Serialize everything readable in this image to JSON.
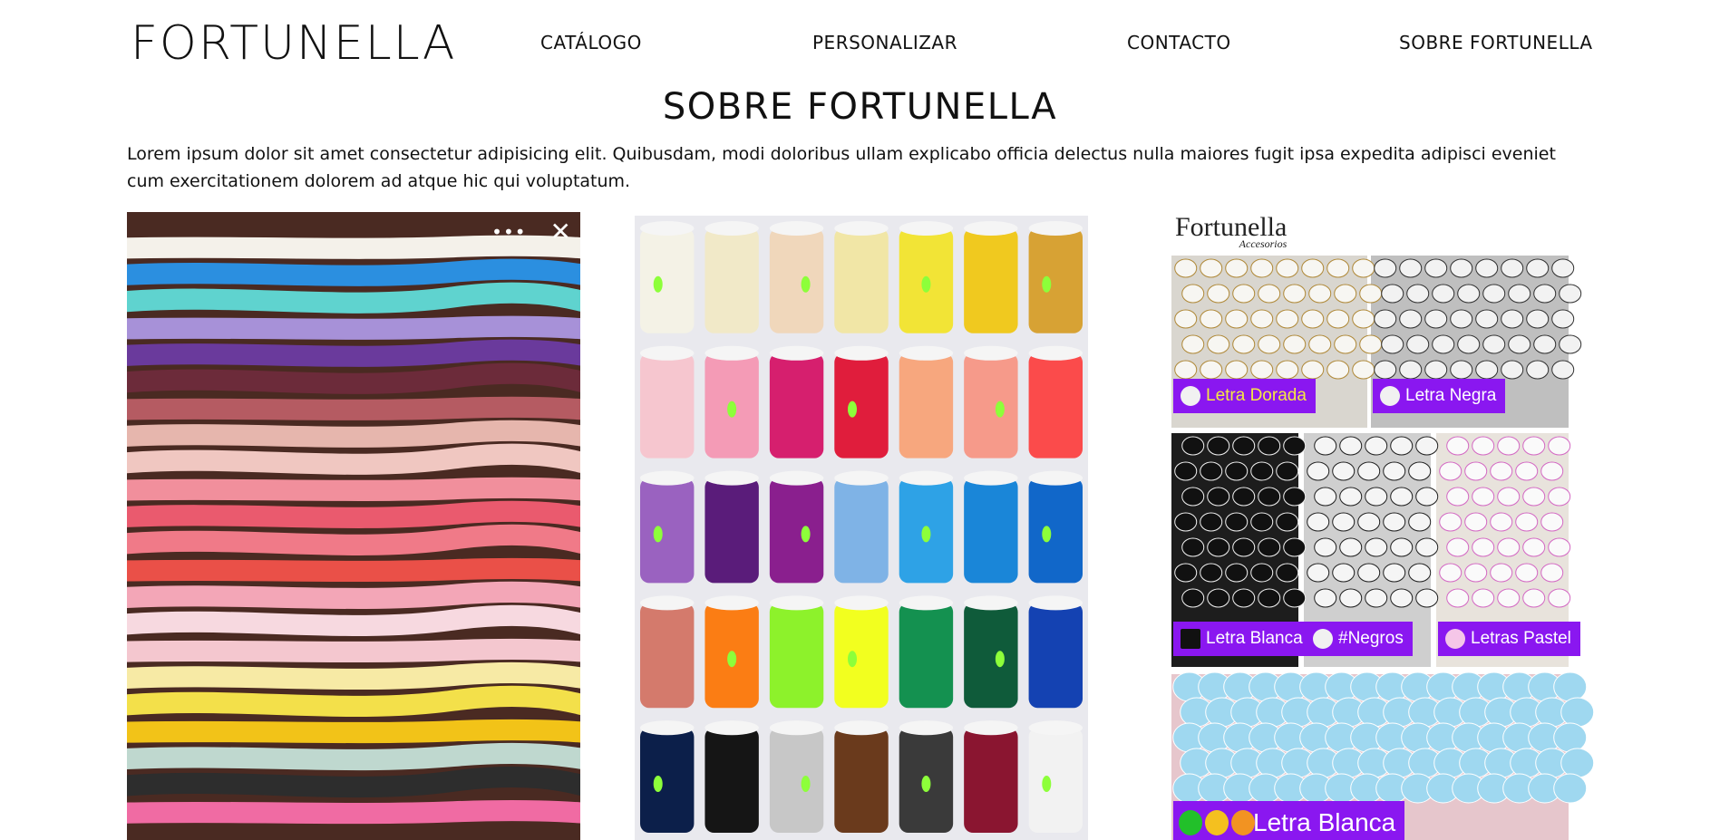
{
  "header": {
    "logo": "FORTUNELLA",
    "nav": [
      {
        "label": "CATÁLOGO"
      },
      {
        "label": "PERSONALIZAR"
      },
      {
        "label": "CONTACTO"
      },
      {
        "label": "SOBRE FORTUNELLA"
      }
    ]
  },
  "main": {
    "title": "SOBRE FORTUNELLA",
    "intro": "Lorem ipsum dolor sit amet consectetur adipisicing elit. Quibusdam, modi doloribus ullam explicabo officia delectus nulla maiores fugit ipsa expedita adipisci eveniet cum exercitationem dolorem ad atque hic qui voluptatum."
  },
  "gallery": {
    "photo1": {
      "icons": [
        "more-dots-icon",
        "close-icon"
      ],
      "dots_glyph": "•••",
      "close_glyph": "✕",
      "colors": [
        "#f4f1ea",
        "#2b8fe0",
        "#5fd3cf",
        "#a791d8",
        "#6a3a9c",
        "#6c2b3a",
        "#b55b62",
        "#e6b6ad",
        "#f0c7c1",
        "#f18f9c",
        "#ea5a6e",
        "#f07a88",
        "#ea5048",
        "#f3a6b7",
        "#f7d9e0",
        "#f4c7cf",
        "#f7eaa5",
        "#f3e04a",
        "#f2c318",
        "#bfd8cf",
        "#2d2d2d",
        "#f06ba3"
      ]
    },
    "photo2": {
      "colors": [
        [
          "#f4f2e6",
          "#f1e9c8",
          "#f0d7bb",
          "#f1e6a6",
          "#f2e436",
          "#f0c91f",
          "#d7a234"
        ],
        [
          "#f6c6cf",
          "#f49bb6",
          "#d61f6e",
          "#e01d3c",
          "#f7a77e",
          "#f69a8a",
          "#fb4b4b"
        ],
        [
          "#9a62c0",
          "#5a1c7a",
          "#8a1f8e",
          "#7fb3e6",
          "#2ea2e6",
          "#1a86d8",
          "#1167c9"
        ],
        [
          "#d47a6c",
          "#fb7d14",
          "#8df22b",
          "#f2ff1f",
          "#149150",
          "#0f5b3a",
          "#1442b2"
        ],
        [
          "#0c1f4a",
          "#151515",
          "#c7c7c7",
          "#6a3a1c",
          "#3a3a3a",
          "#8a1530",
          "#f2f2f2"
        ]
      ],
      "marker_color": "#8dff3a"
    },
    "photo3": {
      "brand": "Fortunella",
      "brand_sub": "Accesorios",
      "labels": [
        {
          "text": "Letra Dorada"
        },
        {
          "text": "Letra Negra"
        },
        {
          "text": "Letra Blanca"
        },
        {
          "text": "#Negros"
        },
        {
          "text": "Letras Pastel"
        },
        {
          "text": "Letra Blanca"
        }
      ],
      "label_bg": "#8a17f0",
      "multi_dot_colors": [
        "#22c02a",
        "#f4c01f",
        "#f29322"
      ]
    }
  }
}
